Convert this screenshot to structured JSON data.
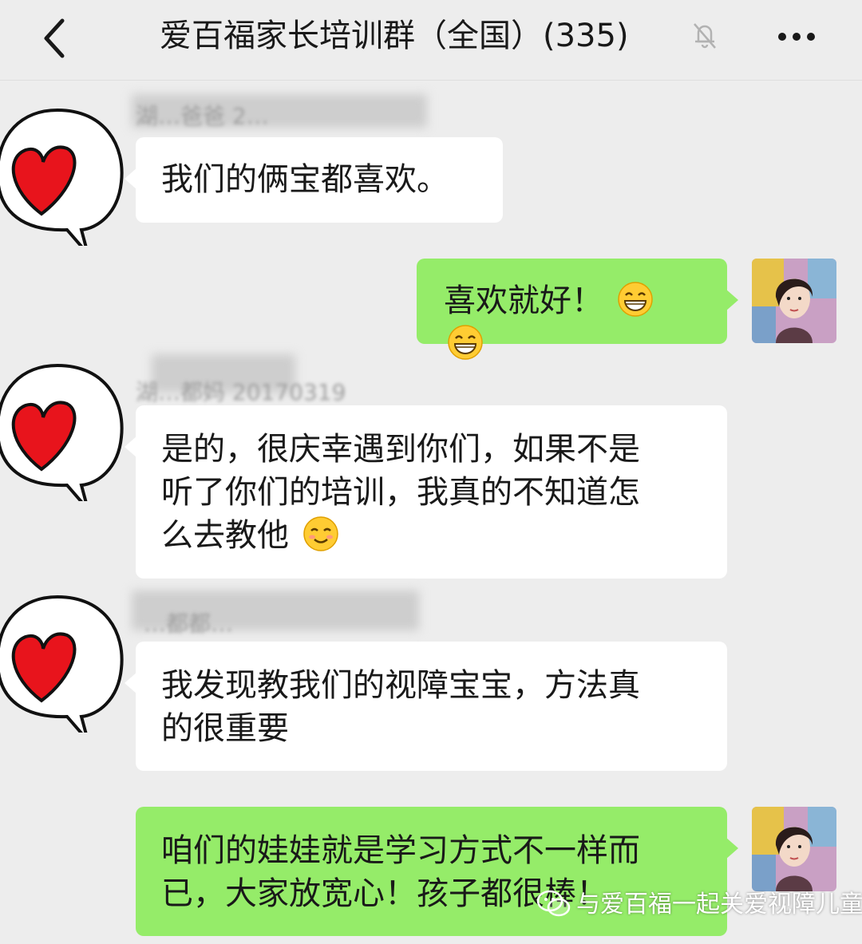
{
  "header": {
    "title": "爱百福家长培训群（全国）(335)",
    "back_icon": "chevron-left-icon",
    "mute_icon": "bell-off-icon",
    "more_icon": "more-dots-icon"
  },
  "messages": [
    {
      "side": "left",
      "sender": "湖…爸爸 2…",
      "text": "我们的俩宝都喜欢。"
    },
    {
      "side": "right",
      "text": "喜欢就好！",
      "emoji": "grin-emoji"
    },
    {
      "side": "left",
      "sender": "湖…都妈 20170319",
      "lines": [
        "是的，很庆幸遇到你们，如果不是",
        "听了你们的培训，我真的不知道怎",
        "么去教他"
      ],
      "emoji": "smile-emoji"
    },
    {
      "side": "left",
      "sender": "…都都…",
      "lines": [
        "我发现教我们的视障宝宝，方法真",
        "的很重要"
      ]
    },
    {
      "side": "right",
      "lines": [
        "咱们的娃娃就是学习方式不一样而",
        "已，大家放宽心！孩子都很棒！"
      ]
    }
  ],
  "watermark": "与爱百福一起关爱视障儿童",
  "colors": {
    "background": "#ededed",
    "self_bubble": "#95ec69",
    "other_bubble": "#ffffff",
    "heart": "#e8141c"
  }
}
